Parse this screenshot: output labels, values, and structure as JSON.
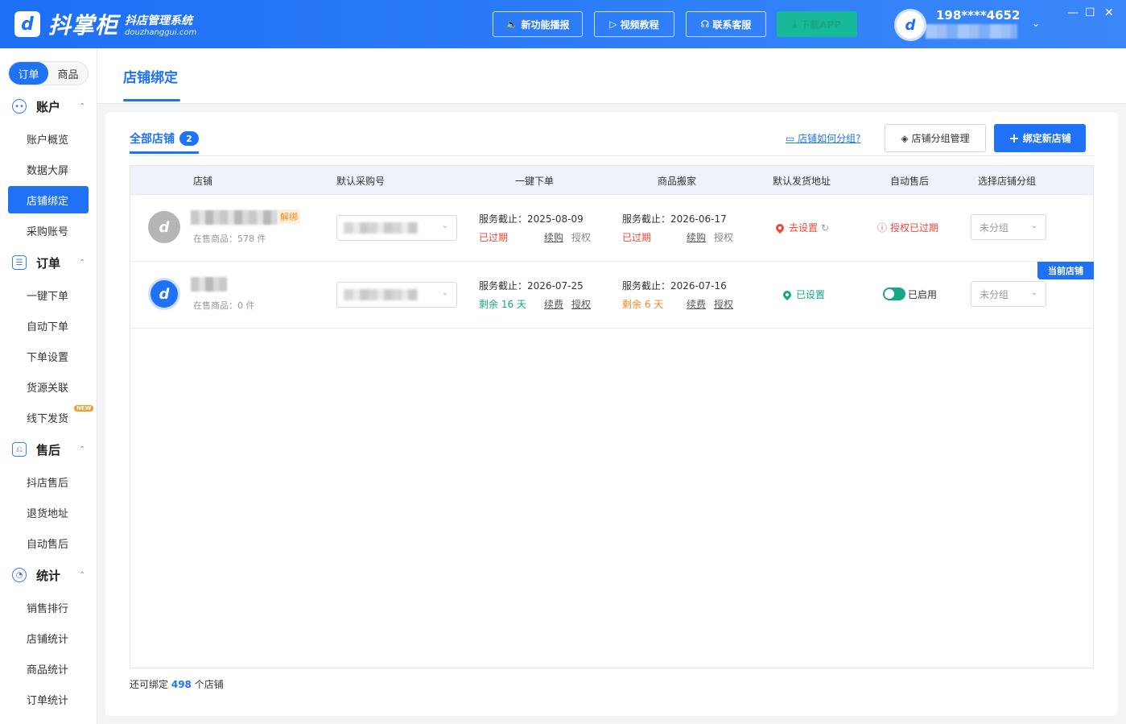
{
  "app": {
    "logo_mark": "d",
    "name": "抖掌柜",
    "subtitle": "抖店管理系统",
    "domain": "douzhanggui.com"
  },
  "header": {
    "buttons": [
      {
        "label": "新功能播报",
        "icon": "speaker-icon"
      },
      {
        "label": "视频教程",
        "icon": "video-icon"
      },
      {
        "label": "联系客服",
        "icon": "headset-icon"
      },
      {
        "label": "下载APP",
        "icon": "download-icon"
      }
    ],
    "user_phone": "198****4652",
    "window_controls": [
      "—",
      "☐",
      "✕"
    ]
  },
  "sidebar": {
    "segment": {
      "order": "订单",
      "product": "商品"
    },
    "groups": [
      {
        "label": "账户",
        "items": [
          "账户概览",
          "数据大屏",
          "店铺绑定",
          "采购账号"
        ]
      },
      {
        "label": "订单",
        "items": [
          "一键下单",
          "自动下单",
          "下单设置",
          "货源关联",
          "线下发货"
        ]
      },
      {
        "label": "售后",
        "items": [
          "抖店售后",
          "退货地址",
          "自动售后"
        ]
      },
      {
        "label": "统计",
        "items": [
          "销售排行",
          "店铺统计",
          "商品统计",
          "订单统计"
        ]
      }
    ],
    "new_badge": "NEW"
  },
  "page": {
    "title": "店铺绑定"
  },
  "toolbar": {
    "tab_all": "全部店铺",
    "tab_count": "2",
    "help_link": "店铺如何分组?",
    "group_manage": "店铺分组管理",
    "bind_new": "绑定新店铺"
  },
  "table": {
    "columns": [
      "店铺",
      "默认采购号",
      "一键下单",
      "商品搬家",
      "默认发货地址",
      "自动售后",
      "选择店铺分组"
    ],
    "rows": [
      {
        "unbind": "解绑",
        "on_sale": "在售商品：578 件",
        "order_service": "服务截止：2025-08-09",
        "order_status": "已过期",
        "order_link1": "续购",
        "order_link2": "授权",
        "move_service": "服务截止：2026-06-17",
        "move_status": "已过期",
        "move_link1": "续购",
        "move_link2": "授权",
        "address": "去设置",
        "after_sale": "授权已过期",
        "group": "未分组"
      },
      {
        "on_sale": "在售商品：0 件",
        "order_service": "服务截止：2026-07-25",
        "order_status": "剩余 16 天",
        "order_link1": "续费",
        "order_link2": "授权",
        "move_service": "服务截止：2026-07-16",
        "move_status": "剩余 6 天",
        "move_link1": "续费",
        "move_link2": "授权",
        "address": "已设置",
        "after_sale": "已启用",
        "group": "未分组",
        "current_tag": "当前店铺"
      }
    ]
  },
  "footer": {
    "prefix": "还可绑定",
    "count": "498",
    "suffix": "个店铺"
  },
  "colors": {
    "primary": "#1f72f6",
    "danger": "#f0473a",
    "success": "#16a884",
    "warning": "#f5892a"
  }
}
